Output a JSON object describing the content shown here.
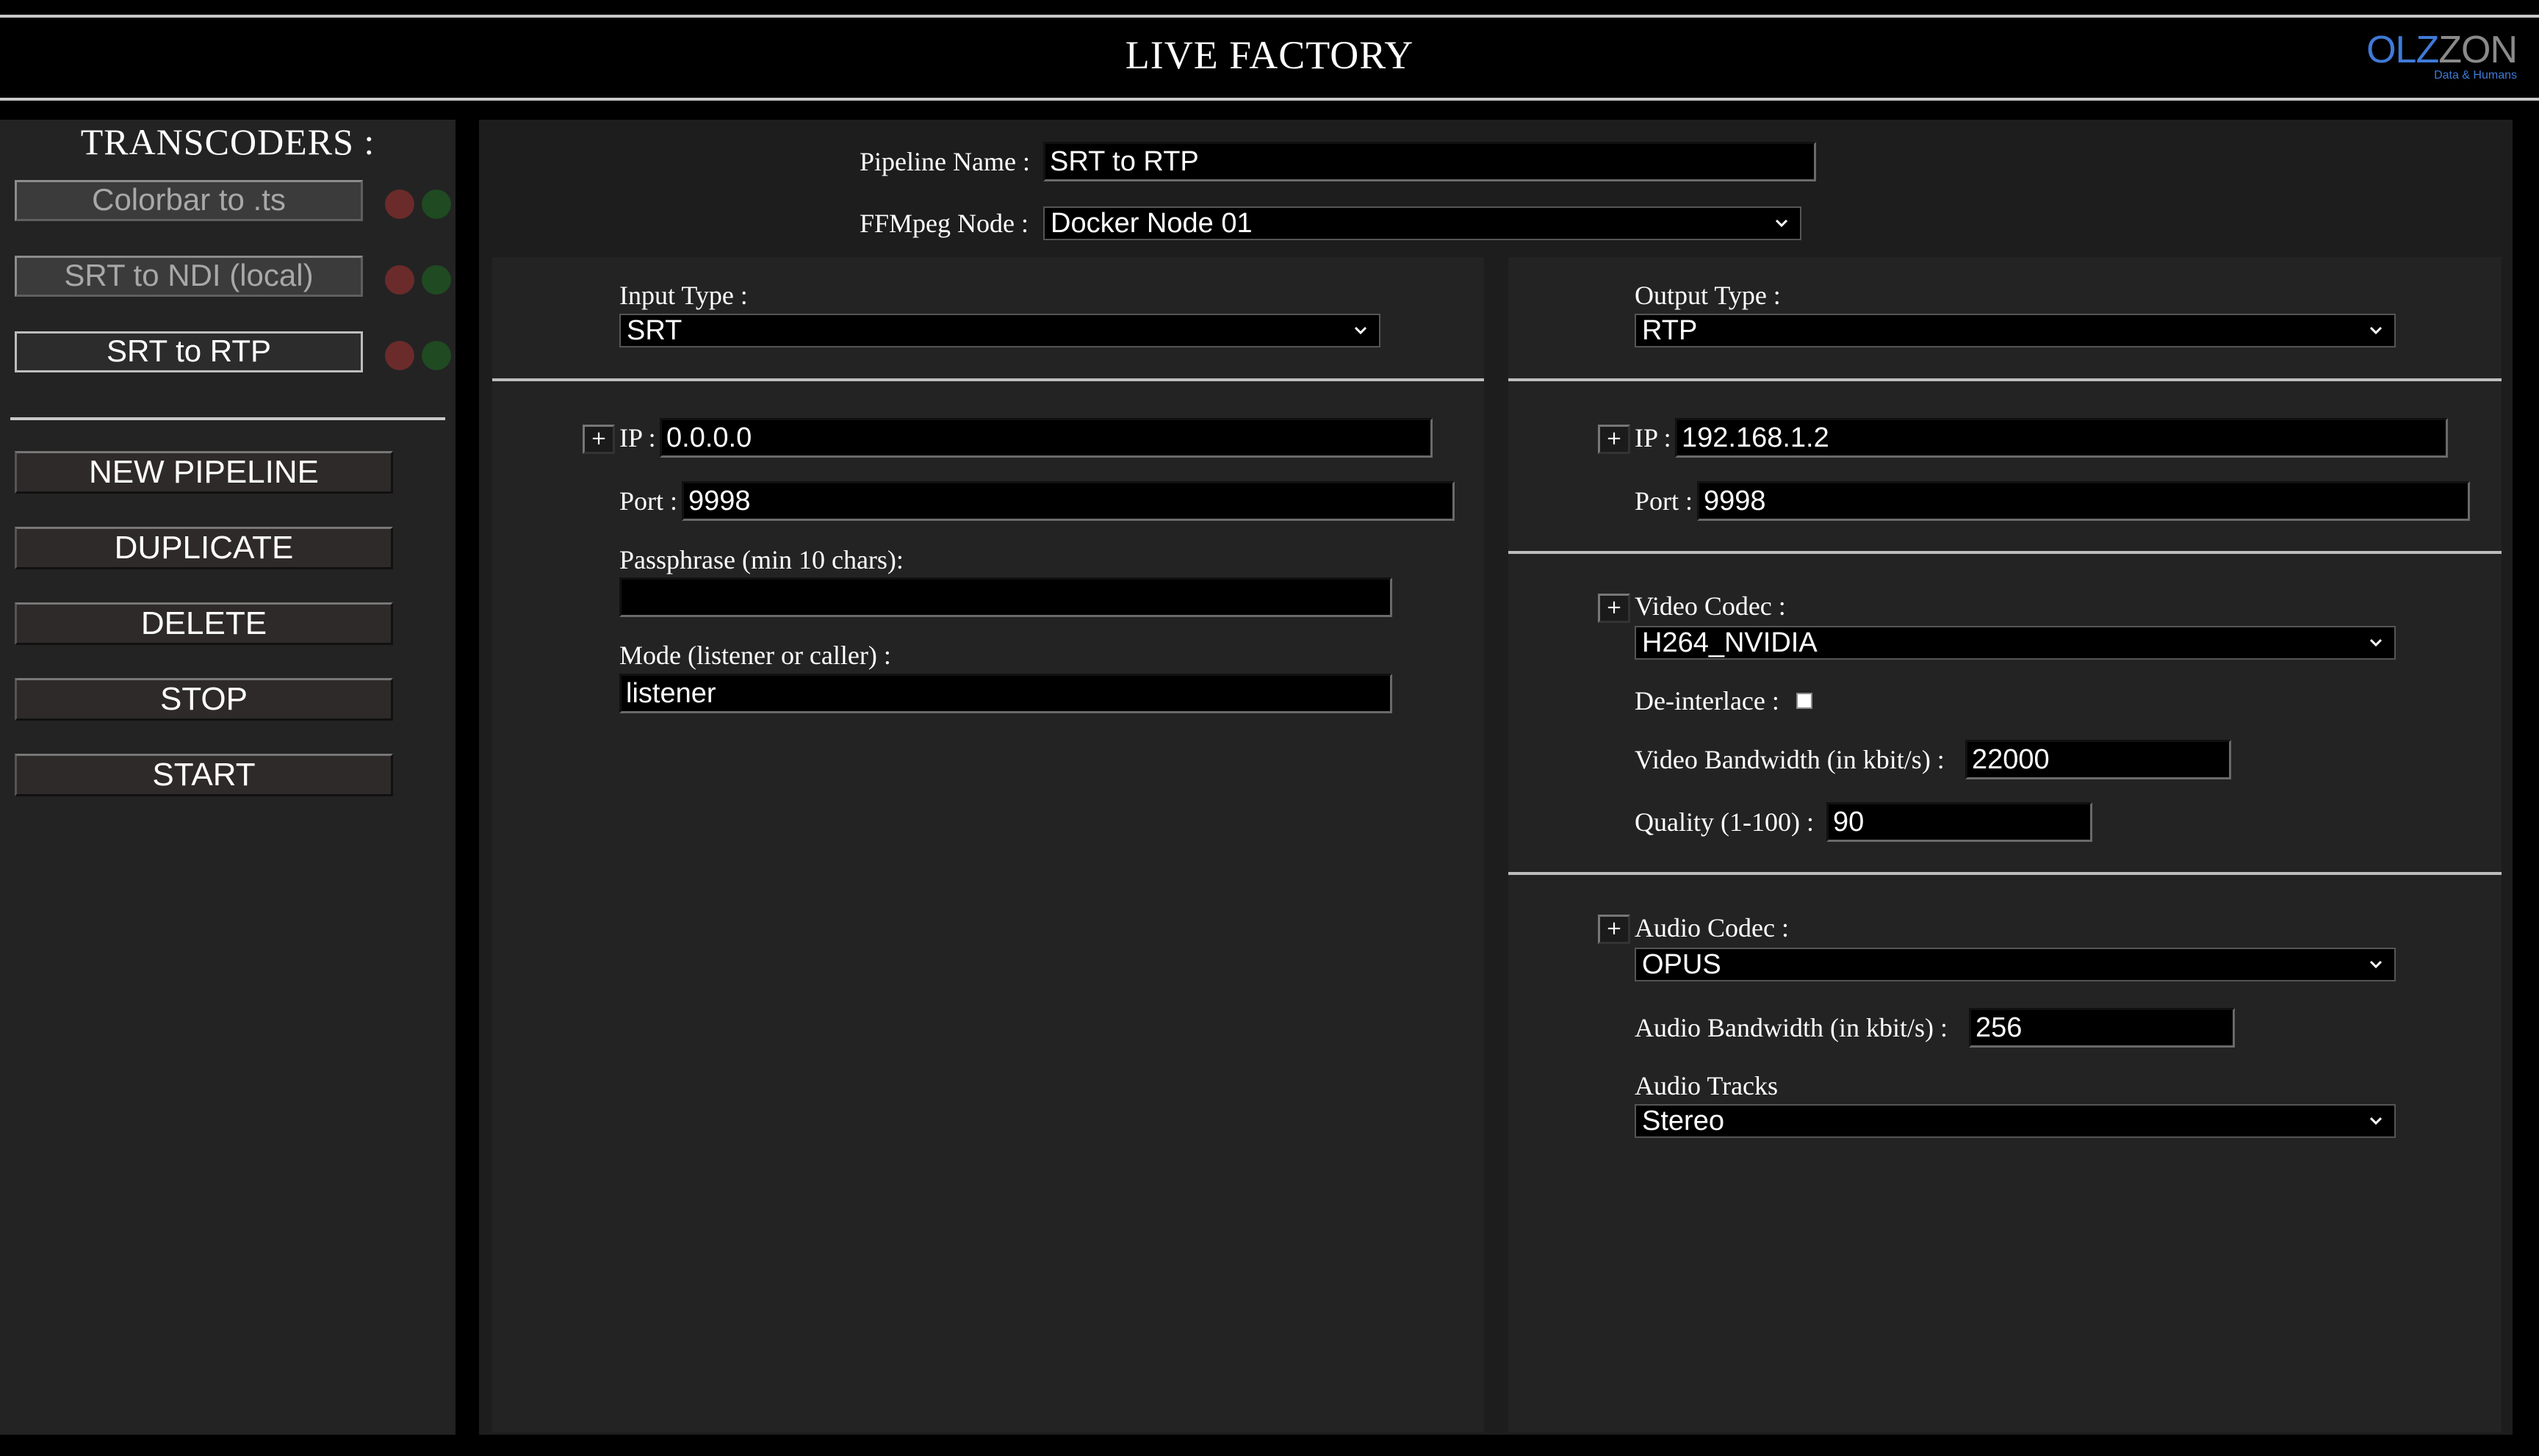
{
  "header": {
    "title": "LIVE FACTORY",
    "logo_part1": "OLZ",
    "logo_part2": "ZON",
    "logo_tagline": "Data & Humans"
  },
  "sidebar": {
    "title": "TRANSCODERS :",
    "transcoders": [
      {
        "label": "Colorbar to .ts"
      },
      {
        "label": "SRT to NDI (local)"
      },
      {
        "label": "SRT to RTP"
      }
    ],
    "actions": {
      "new_pipeline": "NEW PIPELINE",
      "duplicate": "DUPLICATE",
      "delete": "DELETE",
      "stop": "STOP",
      "start": "START"
    }
  },
  "pipeline": {
    "name_label": "Pipeline Name :",
    "name_value": "SRT to RTP",
    "node_label": "FFMpeg Node :",
    "node_value": "Docker Node 01"
  },
  "input": {
    "type_label": "Input Type :",
    "type_value": "SRT",
    "ip_label": "IP :",
    "ip_value": "0.0.0.0",
    "port_label": "Port :",
    "port_value": "9998",
    "passphrase_label": "Passphrase (min 10 chars):",
    "passphrase_value": "",
    "mode_label": "Mode (listener or caller) :",
    "mode_value": "listener"
  },
  "output": {
    "type_label": "Output Type :",
    "type_value": "RTP",
    "ip_label": "IP :",
    "ip_value": "192.168.1.2",
    "port_label": "Port :",
    "port_value": "9998",
    "video_codec_label": "Video Codec :",
    "video_codec_value": "H264_NVIDIA",
    "deinterlace_label": "De-interlace :",
    "video_bw_label": "Video Bandwidth (in kbit/s) :",
    "video_bw_value": "22000",
    "quality_label": "Quality (1-100) :",
    "quality_value": "90",
    "audio_codec_label": "Audio Codec :",
    "audio_codec_value": "OPUS",
    "audio_bw_label": "Audio Bandwidth (in kbit/s) :",
    "audio_bw_value": "256",
    "audio_tracks_label": "Audio Tracks",
    "audio_tracks_value": "Stereo"
  },
  "plus_glyph": "+"
}
